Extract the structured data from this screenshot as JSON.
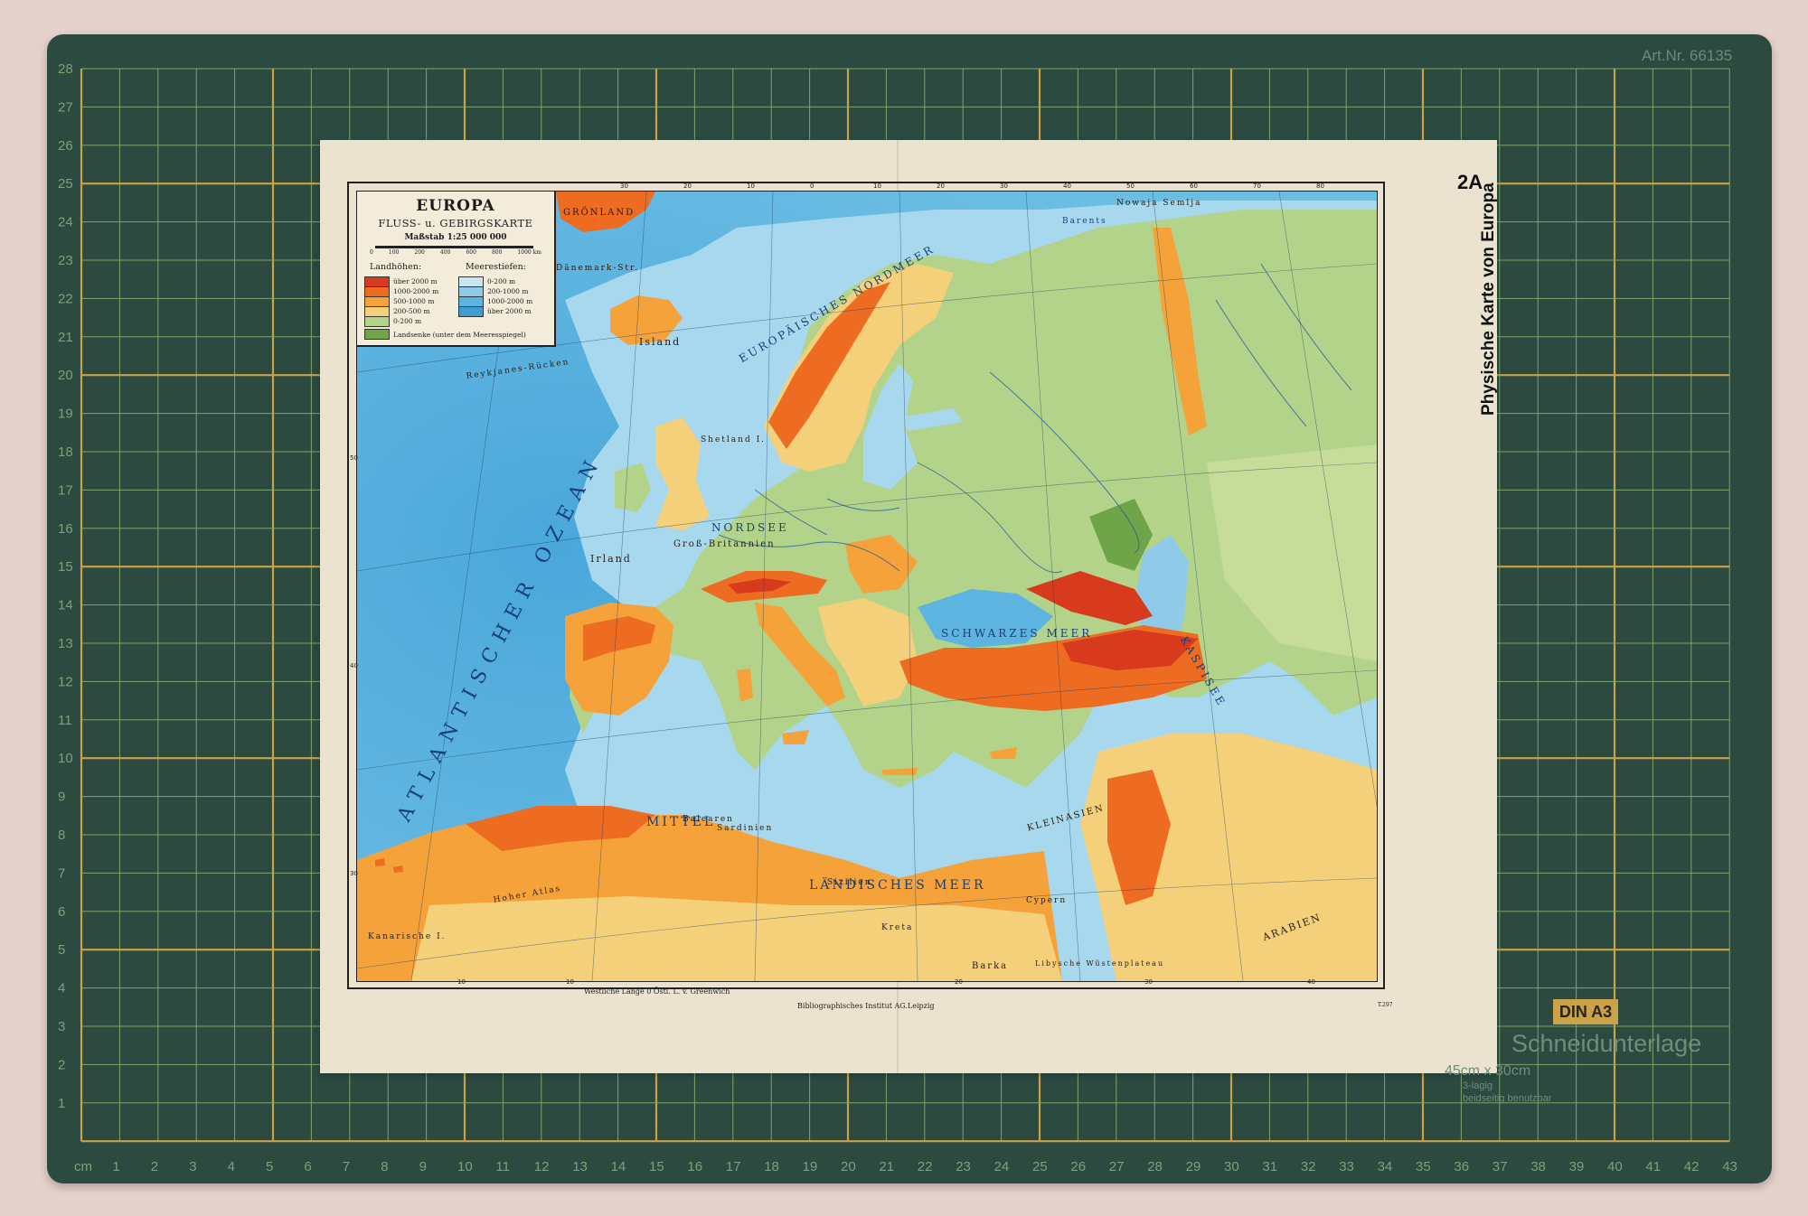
{
  "mat": {
    "article_number": "Art.Nr. 66135",
    "din_label": "DIN A3",
    "product_name": "Schneidunterlage",
    "dimensions": "45cm x 30cm",
    "features": [
      "3-lagig",
      "beidseitig benutzbar"
    ],
    "bottom_ruler": [
      "cm",
      "1",
      "2",
      "3",
      "4",
      "5",
      "6",
      "7",
      "8",
      "9",
      "10",
      "11",
      "12",
      "13",
      "14",
      "15",
      "16",
      "17",
      "18",
      "19",
      "20",
      "21",
      "22",
      "23",
      "24",
      "25",
      "26",
      "27",
      "28",
      "29",
      "30",
      "31",
      "32",
      "33",
      "34",
      "35",
      "36",
      "37",
      "38",
      "39",
      "40",
      "41",
      "42",
      "43"
    ],
    "left_ruler": [
      "28",
      "27",
      "26",
      "25",
      "24",
      "23",
      "22",
      "21",
      "20",
      "19",
      "18",
      "17",
      "16",
      "15",
      "14",
      "13",
      "12",
      "11",
      "10",
      "9",
      "8",
      "7",
      "6",
      "5",
      "4",
      "3",
      "2",
      "1"
    ],
    "colors": {
      "mat": "#2c4a40",
      "grid_major": "#c9a24a",
      "grid_minor": "#7aa66a"
    }
  },
  "sheet": {
    "page_number": "2A",
    "side_title": "Physische Karte von Europa",
    "publisher": "Bibliographisches Institut AG.Leipzig",
    "longitude_note": "Westliche Länge  0  Östl. L. v. Greenwich",
    "plate_code": "T.297"
  },
  "legend": {
    "title": "EUROPA",
    "subtitle": "FLUSS- u. GEBIRGSKARTE",
    "scale": "Maßstab 1:25 000 000",
    "scale_ticks": [
      "0",
      "100",
      "200",
      "400",
      "600",
      "800",
      "1000 km"
    ],
    "land_heading": "Landhöhen:",
    "sea_heading": "Meerestiefen:",
    "land": [
      {
        "label": "über 2000 m",
        "color": "#d83a1e"
      },
      {
        "label": "1000-2000 m",
        "color": "#ee6b22"
      },
      {
        "label": "500-1000 m",
        "color": "#f5a23a"
      },
      {
        "label": "200-500 m",
        "color": "#f4d07a"
      },
      {
        "label": "0-200 m",
        "color": "#b3d38a"
      }
    ],
    "sea": [
      {
        "label": "0-200 m",
        "color": "#c9e5f1"
      },
      {
        "label": "200-1000 m",
        "color": "#8fcbe8"
      },
      {
        "label": "1000-2000 m",
        "color": "#5db4e0"
      },
      {
        "label": "über 2000 m",
        "color": "#3f9dd4"
      }
    ],
    "depression": {
      "label": "Landsenke (unter dem Meeresspiegel)",
      "color": "#6fa548"
    }
  },
  "map": {
    "top_longitudes": [
      "30",
      "20",
      "10",
      "0",
      "10",
      "20",
      "30",
      "40",
      "50",
      "60",
      "70",
      "80"
    ],
    "bottom_longitudes": [
      "10",
      "10",
      "20",
      "30",
      "40"
    ],
    "left_latitudes": [
      "50",
      "40",
      "30"
    ],
    "labels": {
      "atlantic": "ATLANTISCHER OZEAN",
      "nordmeer": "EUROPÄISCHES NORDMEER",
      "nordsee": "NORDSEE",
      "mittelmeer_west": "MITTEL",
      "mittelmeer_east": "LÄNDISCHES MEER",
      "schwarzes_meer": "SCHWARZES MEER",
      "kaspisee": "KASPISEE",
      "island": "Island",
      "irland": "Irland",
      "grossbritannien": "Groß-Britannien",
      "groenland": "GRÖNLAND",
      "reykjanes": "Reykjanes-Rücken",
      "daenemark_str": "Dänemark-Str.",
      "shetland": "Shetland I.",
      "balearen": "Balearen",
      "sardinien": "Sardinien",
      "sizilien": "Sizilien",
      "kreta": "Kreta",
      "cypern": "Cypern",
      "kanarische": "Kanarische I.",
      "arabien": "ARABIEN",
      "barka": "Barka",
      "libysche": "Libysche Wüstenplateau",
      "barents": "Barents",
      "nowaja": "Nowaja Semlja",
      "atlas": "Hoher Atlas",
      "kleinasien": "KLEINASIEN"
    }
  }
}
